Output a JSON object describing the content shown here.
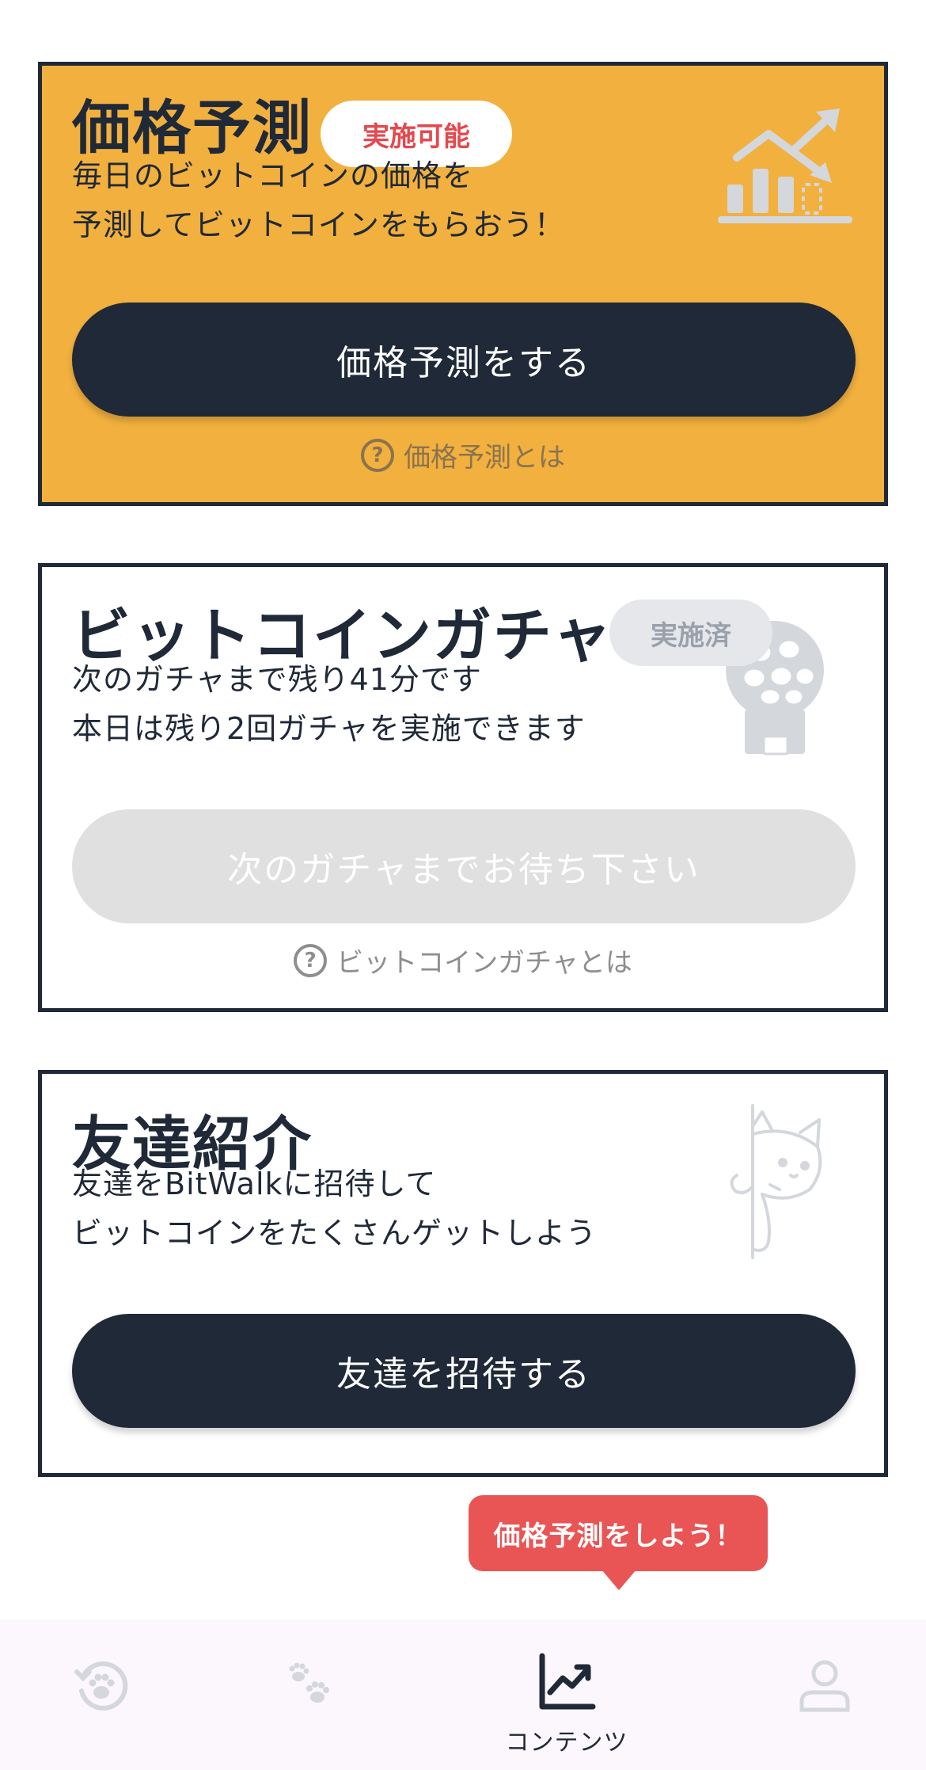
{
  "price_card": {
    "title": "価格予測",
    "badge": "実施可能",
    "description_line1": "毎日のビットコインの価格を",
    "description_line2": "予測してビットコインをもらおう！",
    "button_label": "価格予測をする",
    "help_label": "価格予測とは",
    "background_color": "#f2b03e",
    "icon": "chart-growth-icon"
  },
  "gacha_card": {
    "title": "ビットコインガチャ",
    "badge": "実施済",
    "description_line1": "次のガチャまで残り41分です",
    "description_line2": "本日は残り2回ガチャを実施できます",
    "button_label": "次のガチャまでお待ち下さい",
    "help_label": "ビットコインガチャとは",
    "icon": "gacha-machine-icon"
  },
  "friend_card": {
    "title": "友達紹介",
    "description_line1": "友達をBitWalkに招待して",
    "description_line2": "ビットコインをたくさんゲットしよう",
    "button_label": "友達を招待する",
    "icon": "peeking-cat-icon"
  },
  "tooltip": {
    "text": "価格予測をしよう！",
    "color": "#e95454"
  },
  "bottom_nav": {
    "items": [
      {
        "icon": "paw-history-icon",
        "label": ""
      },
      {
        "icon": "paw-icon",
        "label": ""
      },
      {
        "icon": "chart-up-icon",
        "label": "コンテンツ"
      },
      {
        "icon": "person-icon",
        "label": ""
      }
    ],
    "active_index": 2
  }
}
